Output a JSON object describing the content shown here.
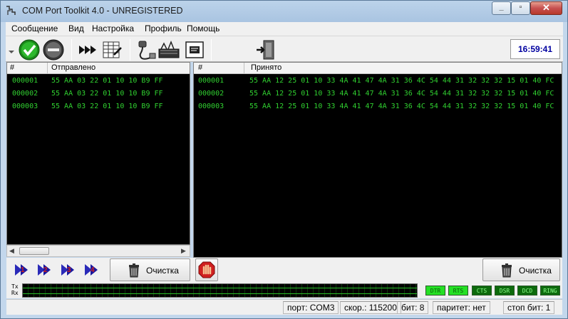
{
  "window": {
    "title": "COM Port Toolkit 4.0 - UNREGISTERED",
    "minimize_icon": "minimize-icon",
    "maximize_icon": "maximize-icon",
    "close_icon": "close-icon"
  },
  "menu": {
    "items": [
      "Сообщение",
      "Вид",
      "Настройка",
      "Профиль",
      "Помощь"
    ]
  },
  "toolbar": {
    "icons": [
      "dropdown-arrow-icon",
      "connect-check-icon",
      "disconnect-icon",
      "send-all-icon",
      "log-table-icon",
      "cable-settings-icon",
      "modem-icon",
      "terminal-icon",
      "exit-door-icon"
    ],
    "clock": "16:59:41"
  },
  "sent": {
    "headers": [
      "#",
      "Отправлено"
    ],
    "rows": [
      {
        "num": "000001",
        "data": "55 AA 03 22 01 10 10 B9 FF"
      },
      {
        "num": "000002",
        "data": "55 AA 03 22 01 10 10 B9 FF"
      },
      {
        "num": "000003",
        "data": "55 AA 03 22 01 10 10 B9 FF"
      }
    ]
  },
  "received": {
    "headers": [
      "#",
      "Принято"
    ],
    "rows": [
      {
        "num": "000001",
        "data": "55 AA 12 25 01 10 33 4A 41 47 4A 31 36 4C 54 44 31 32 32 32 15 01 40 FC"
      },
      {
        "num": "000002",
        "data": "55 AA 12 25 01 10 33 4A 41 47 4A 31 36 4C 54 44 31 32 32 32 15 01 40 FC"
      },
      {
        "num": "000003",
        "data": "55 AA 12 25 01 10 33 4A 41 47 4A 31 36 4C 54 44 31 32 32 32 15 01 40 FC"
      }
    ]
  },
  "bottom": {
    "send_icons": [
      "send-1-icon",
      "send-2-icon",
      "send-3-icon",
      "send-4-icon"
    ],
    "clear_label_left": "Очистка",
    "clear_label_right": "Очистка",
    "stop_icon": "stop-hand-icon"
  },
  "signals": {
    "tx_label": "Tx",
    "rx_label": "Rx",
    "leds": [
      {
        "label": "DTR",
        "on": true
      },
      {
        "label": "RTS",
        "on": true
      },
      {
        "label": "CTS",
        "on": false
      },
      {
        "label": "DSR",
        "on": false
      },
      {
        "label": "DCD",
        "on": false
      },
      {
        "label": "RING",
        "on": false
      }
    ]
  },
  "status": {
    "port": "порт: COM3",
    "speed": "скор.: 115200",
    "bits": "бит: 8",
    "parity": "паритет: нет",
    "stop_bits": "стоп бит: 1"
  },
  "colors": {
    "data_text": "#30d030",
    "clock_text": "#0000a0",
    "led_on": "#25e025",
    "led_off": "#0d6a0d"
  }
}
